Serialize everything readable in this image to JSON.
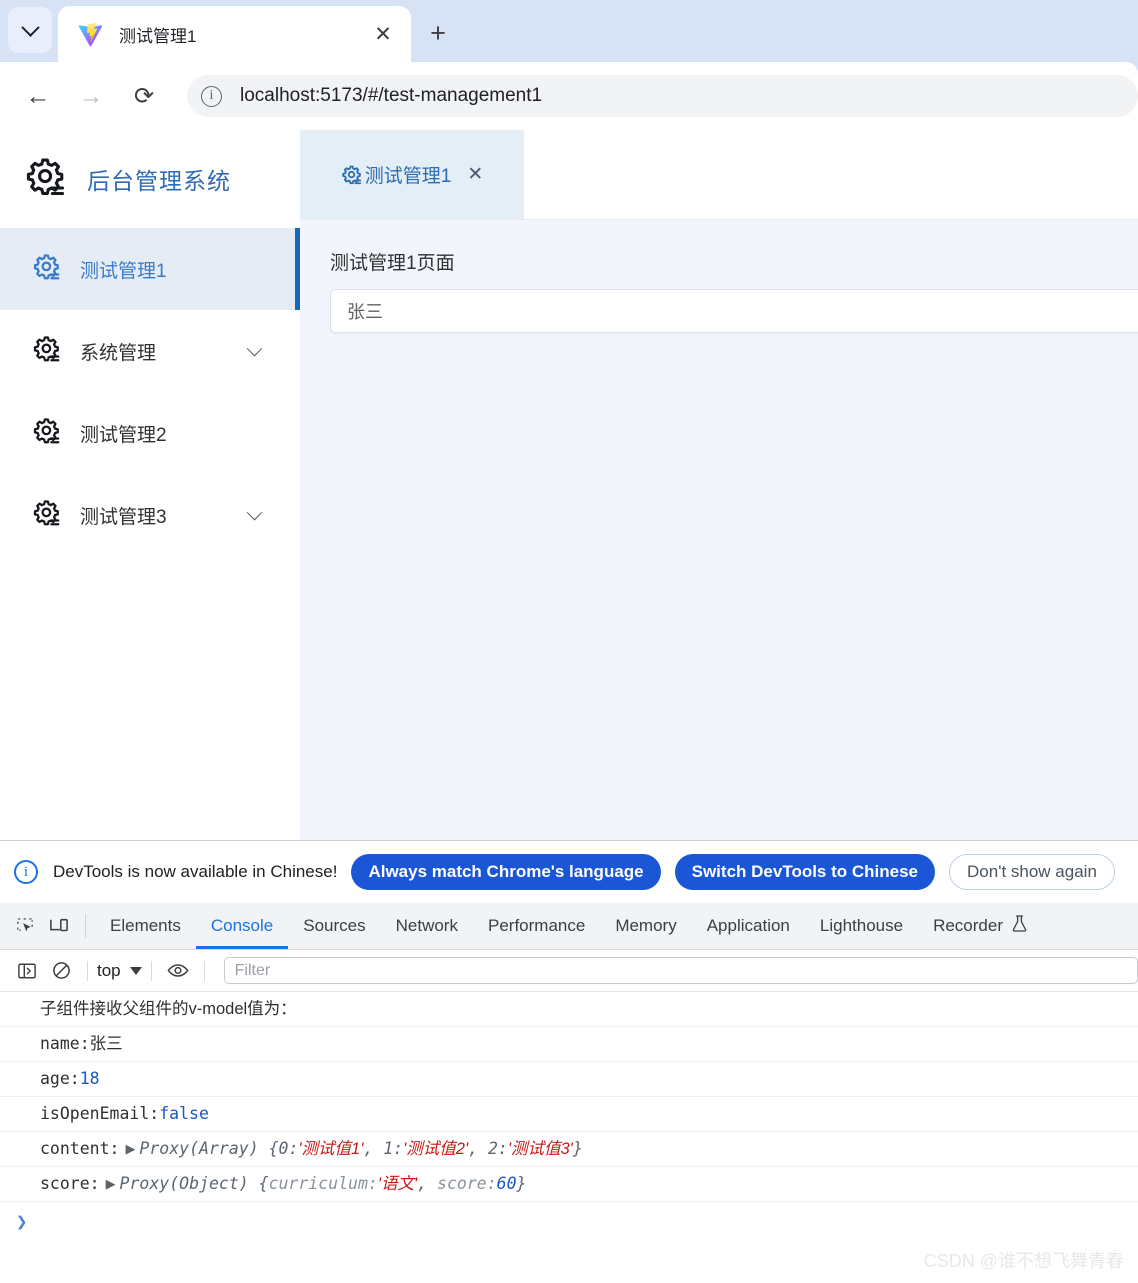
{
  "browser": {
    "tab_title": "测试管理1",
    "tab_favicon": "vite-logo-icon",
    "close_label": "✕",
    "newtab_label": "+",
    "back_label": "←",
    "forward_label": "→",
    "reload_label": "⟳",
    "url": "localhost:5173/#/test-management1",
    "site_info_icon": "info-circle-icon",
    "tabstrip_dropdown_icon": "chevron-down-icon"
  },
  "sidebar": {
    "brand": "后台管理系统",
    "brand_icon": "gear-icon",
    "brand_color": "#2d6bb5",
    "active_accent": "#1668ba",
    "items": [
      {
        "label": "测试管理1",
        "icon": "gear-icon",
        "active": true,
        "expandable": false
      },
      {
        "label": "系统管理",
        "icon": "gear-icon",
        "active": false,
        "expandable": true
      },
      {
        "label": "测试管理2",
        "icon": "gear-icon",
        "active": false,
        "expandable": false
      },
      {
        "label": "测试管理3",
        "icon": "gear-icon",
        "active": false,
        "expandable": true
      }
    ]
  },
  "app_tabs": [
    {
      "label": "测试管理1",
      "icon": "gear-icon",
      "close": "✕",
      "active": true
    }
  ],
  "page": {
    "title": "测试管理1页面",
    "input_value": "张三"
  },
  "devtools": {
    "banner": {
      "icon": "info-circle-icon",
      "text": "DevTools is now available in Chinese!",
      "primary_button": "Always match Chrome's language",
      "secondary_button": "Switch DevTools to Chinese",
      "dismiss_button": "Don't show again",
      "button_color": "#1a56d6"
    },
    "inspect_icon": "inspect-element-icon",
    "device_icon": "device-toolbar-icon",
    "tabs": [
      {
        "label": "Elements",
        "selected": false
      },
      {
        "label": "Console",
        "selected": true
      },
      {
        "label": "Sources",
        "selected": false
      },
      {
        "label": "Network",
        "selected": false
      },
      {
        "label": "Performance",
        "selected": false
      },
      {
        "label": "Memory",
        "selected": false
      },
      {
        "label": "Application",
        "selected": false
      },
      {
        "label": "Lighthouse",
        "selected": false
      },
      {
        "label": "Recorder",
        "selected": false,
        "trailing_icon": "flask-icon"
      }
    ],
    "toolbar": {
      "sidebar_icon": "console-sidebar-icon",
      "clear_icon": "clear-console-icon",
      "context": "top",
      "context_caret": "caret-down-icon",
      "eye_icon": "live-expression-icon",
      "filter_placeholder": "Filter"
    },
    "console_rows": [
      {
        "type": "plain",
        "text": "子组件接收父组件的v-model值为："
      },
      {
        "type": "kv",
        "key": "name: ",
        "value": "张三",
        "value_class": "cjk"
      },
      {
        "type": "kv",
        "key": "age: ",
        "value": "18",
        "value_class": "num"
      },
      {
        "type": "kv",
        "key": "isOpenEmail: ",
        "value": "false",
        "value_class": "kw"
      },
      {
        "type": "proxy_array",
        "key": "content: ",
        "proxy": "Proxy(Array)",
        "entries": [
          {
            "index": "0: ",
            "value": "'测试值1'"
          },
          {
            "index": "1: ",
            "value": "'测试值2'"
          },
          {
            "index": "2: ",
            "value": "'测试值3'"
          }
        ]
      },
      {
        "type": "proxy_object",
        "key": "score: ",
        "proxy": "Proxy(Object)",
        "props": [
          {
            "name": "curriculum: ",
            "value": "'语文'",
            "is_string": true
          },
          {
            "name": "score: ",
            "value": "60",
            "is_string": false
          }
        ]
      }
    ],
    "prompt": "❯"
  },
  "watermark": "CSDN @谁不想飞舞青春"
}
